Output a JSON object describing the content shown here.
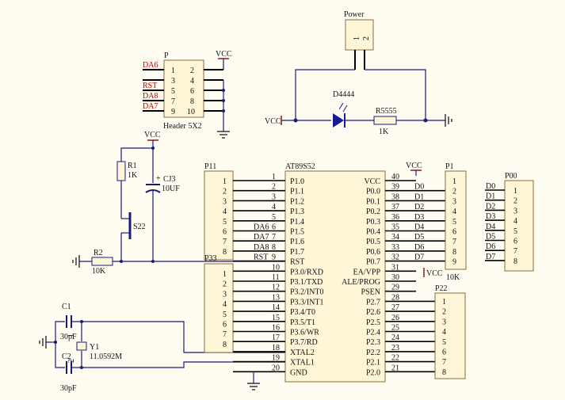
{
  "background": "#fffdf2",
  "colors": {
    "wire": "#1a1a7a",
    "net_label": "#c00000",
    "part_fill": "#fff6d8",
    "part_border": "#8a6a3a",
    "junction": "#1a1a7a"
  },
  "power": {
    "label": "Power",
    "pin_numbers": [
      "1",
      "2"
    ],
    "vcc_label": "VCC",
    "led_ref": "D4444",
    "resistor_ref": "R5555",
    "resistor_value": "1K"
  },
  "header_p": {
    "ref": "P",
    "name": "Header 5X2",
    "vcc_label": "VCC",
    "rows": [
      {
        "left_net": "DA6",
        "left_pin": "1",
        "right_pin": "2"
      },
      {
        "left_net": "",
        "left_pin": "3",
        "right_pin": "4"
      },
      {
        "left_net": "RST",
        "left_pin": "5",
        "right_pin": "6"
      },
      {
        "left_net": "DA8",
        "left_pin": "7",
        "right_pin": "8"
      },
      {
        "left_net": "DA7",
        "left_pin": "9",
        "right_pin": "10"
      }
    ]
  },
  "reset": {
    "vcc_label": "VCC",
    "r1_ref": "R1",
    "r1_value": "1K",
    "cap_ref": "CJ3",
    "cap_value": "10UF",
    "switch_ref": "S22",
    "r2_ref": "R2",
    "r2_value": "10K"
  },
  "crystal": {
    "c1_ref": "C1",
    "c1_value": "30pF",
    "c2_ref": "C2",
    "c2_value": "30pF",
    "y_ref": "Y1",
    "y_value": "11.0592M",
    "pin1": "1",
    "pin2": "2"
  },
  "mcu": {
    "name": "AT89S52",
    "left": [
      {
        "num": "1",
        "name": "P1.0",
        "net": ""
      },
      {
        "num": "2",
        "name": "P1.1",
        "net": ""
      },
      {
        "num": "3",
        "name": "P1.2",
        "net": ""
      },
      {
        "num": "4",
        "name": "P1.3",
        "net": ""
      },
      {
        "num": "5",
        "name": "P1.4",
        "net": ""
      },
      {
        "num": "6",
        "name": "P1.5",
        "net": "DA6"
      },
      {
        "num": "7",
        "name": "P1.6",
        "net": "DA7"
      },
      {
        "num": "8",
        "name": "P1.7",
        "net": "DA8"
      },
      {
        "num": "9",
        "name": "RST",
        "net": "RST"
      },
      {
        "num": "10",
        "name": "P3.0/RXD",
        "net": ""
      },
      {
        "num": "11",
        "name": "P3.1/TXD",
        "net": ""
      },
      {
        "num": "12",
        "name": "P3.2/INT0",
        "net": ""
      },
      {
        "num": "13",
        "name": "P3.3/INT1",
        "net": ""
      },
      {
        "num": "14",
        "name": "P3.4/T0",
        "net": ""
      },
      {
        "num": "15",
        "name": "P3.5/T1",
        "net": ""
      },
      {
        "num": "16",
        "name": "P3.6/WR",
        "net": ""
      },
      {
        "num": "17",
        "name": "P3.7/RD",
        "net": ""
      },
      {
        "num": "18",
        "name": "XTAL2",
        "net": ""
      },
      {
        "num": "19",
        "name": "XTAL1",
        "net": ""
      },
      {
        "num": "20",
        "name": "GND",
        "net": ""
      }
    ],
    "right": [
      {
        "num": "40",
        "name": "VCC",
        "net": ""
      },
      {
        "num": "39",
        "name": "P0.0",
        "net": "D0"
      },
      {
        "num": "38",
        "name": "P0.1",
        "net": "D1"
      },
      {
        "num": "37",
        "name": "P0.2",
        "net": "D2"
      },
      {
        "num": "36",
        "name": "P0.3",
        "net": "D3"
      },
      {
        "num": "35",
        "name": "P0.4",
        "net": "D4"
      },
      {
        "num": "34",
        "name": "P0.5",
        "net": "D5"
      },
      {
        "num": "33",
        "name": "P0.6",
        "net": "D6"
      },
      {
        "num": "32",
        "name": "P0.7",
        "net": "D7"
      },
      {
        "num": "31",
        "name": "EA/VPP",
        "net": ""
      },
      {
        "num": "30",
        "name": "ALE/PROG",
        "net": ""
      },
      {
        "num": "29",
        "name": "PSEN",
        "net": ""
      },
      {
        "num": "28",
        "name": "P2.7",
        "net": ""
      },
      {
        "num": "27",
        "name": "P2.6",
        "net": ""
      },
      {
        "num": "26",
        "name": "P2.5",
        "net": ""
      },
      {
        "num": "25",
        "name": "P2.4",
        "net": ""
      },
      {
        "num": "24",
        "name": "P2.3",
        "net": ""
      },
      {
        "num": "23",
        "name": "P2.2",
        "net": ""
      },
      {
        "num": "22",
        "name": "P2.1",
        "net": ""
      },
      {
        "num": "21",
        "name": "P2.0",
        "net": ""
      }
    ],
    "vcc_label": "VCC",
    "ea_vcc_label": "VCC"
  },
  "p11": {
    "ref": "P11",
    "pins": [
      "1",
      "2",
      "3",
      "4",
      "5",
      "6",
      "7",
      "8"
    ]
  },
  "p33": {
    "ref": "P33",
    "pins": [
      "1",
      "2",
      "3",
      "4",
      "5",
      "6",
      "7",
      "8"
    ]
  },
  "p1": {
    "ref": "P1",
    "pins": [
      "1",
      "2",
      "3",
      "4",
      "5",
      "6",
      "7",
      "8",
      "9"
    ],
    "value": "10K"
  },
  "p22": {
    "ref": "P22",
    "pins": [
      "1",
      "2",
      "3",
      "4",
      "5",
      "6",
      "7",
      "8"
    ]
  },
  "p00": {
    "ref": "P00",
    "pins": [
      "1",
      "2",
      "3",
      "4",
      "5",
      "6",
      "7",
      "8"
    ],
    "nets": [
      "D0",
      "D1",
      "D2",
      "D3",
      "D4",
      "D5",
      "D6",
      "D7"
    ]
  }
}
